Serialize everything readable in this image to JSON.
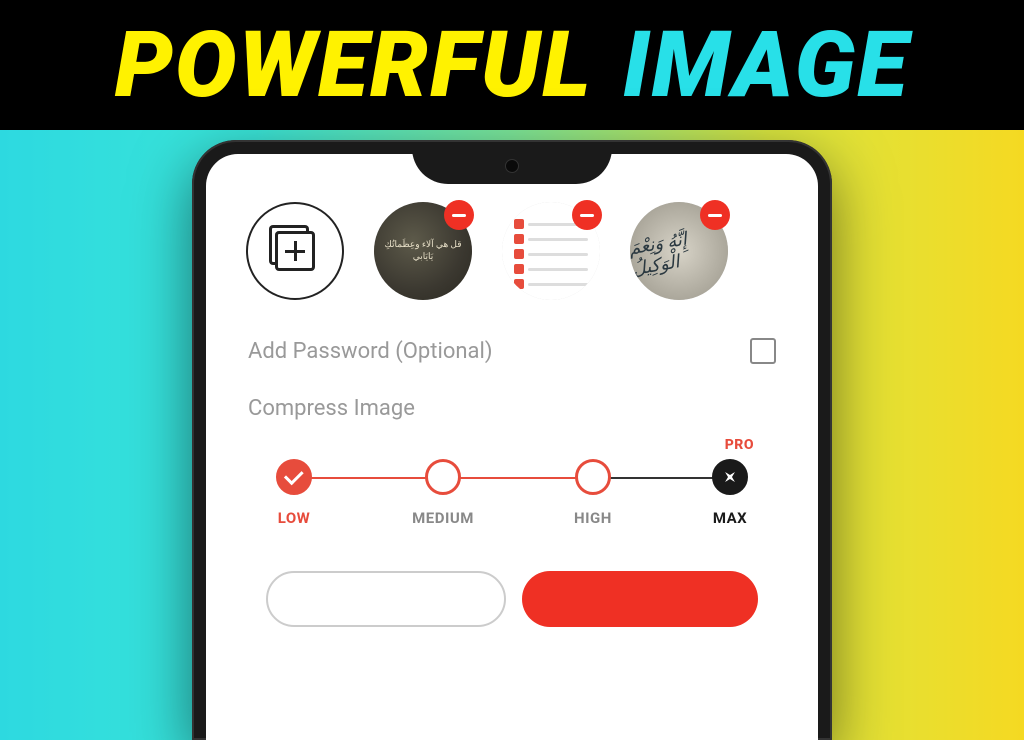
{
  "banner": {
    "word1": "POWERFUL",
    "word2": "IMAGE"
  },
  "thumbs": {
    "thumb1_text": "قل هي آلاء وعِظَماتُكِ يَايَابي",
    "thumb3_text": "إِنَّهُ وَنِعْمَ الْوَكِيلُ"
  },
  "password": {
    "label": "Add Password (Optional)"
  },
  "compress": {
    "label": "Compress Image",
    "pro_badge": "PRO",
    "nodes": {
      "low": "LOW",
      "medium": "MEDIUM",
      "high": "HIGH",
      "max": "MAX"
    }
  }
}
